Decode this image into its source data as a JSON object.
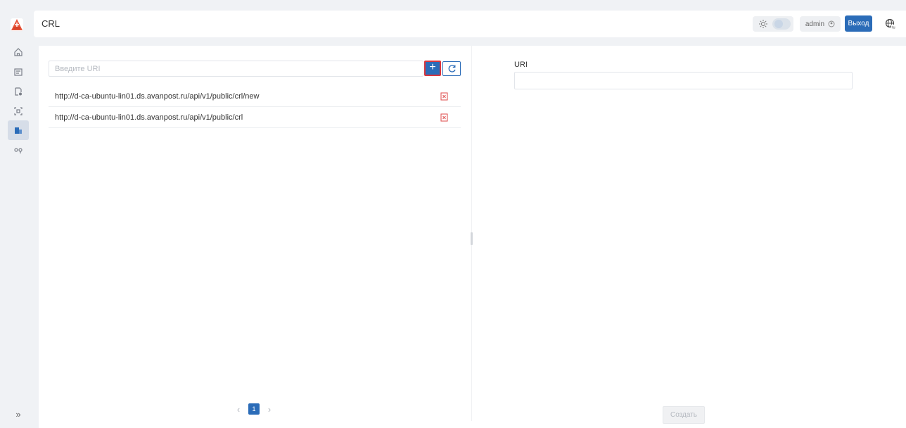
{
  "app": {
    "page_title": "CRL"
  },
  "colors": {
    "primary": "#2b6cb8",
    "danger": "#d9363e"
  },
  "sidebar": {
    "logo_icon": "app-logo-icon",
    "items": [
      {
        "icon": "home-icon",
        "active": false
      },
      {
        "icon": "certificate-list-icon",
        "active": false
      },
      {
        "icon": "certificate-settings-icon",
        "active": false
      },
      {
        "icon": "scan-icon",
        "active": false
      },
      {
        "icon": "crl-folder-icon",
        "active": true
      },
      {
        "icon": "keys-icon",
        "active": false
      }
    ],
    "expand_label": "»"
  },
  "header": {
    "theme_toggle": {
      "icon": "sun-icon",
      "dark_mode": false
    },
    "user": {
      "name": "admin",
      "icon": "user-circle-icon"
    },
    "logout_label": "Выход",
    "language_icon": "language-globe-icon"
  },
  "left_panel": {
    "search": {
      "placeholder": "Введите URI",
      "value": ""
    },
    "add_label": "+",
    "refresh_icon": "refresh-icon",
    "items": [
      {
        "uri": "http://d-ca-ubuntu-lin01.ds.avanpost.ru/api/v1/public/crl/new"
      },
      {
        "uri": "http://d-ca-ubuntu-lin01.ds.avanpost.ru/api/v1/public/crl"
      }
    ],
    "pagination": {
      "prev": "‹",
      "current": "1",
      "next": "›"
    }
  },
  "right_panel": {
    "uri_label": "URI",
    "uri_value": "",
    "create_label": "Создать"
  }
}
